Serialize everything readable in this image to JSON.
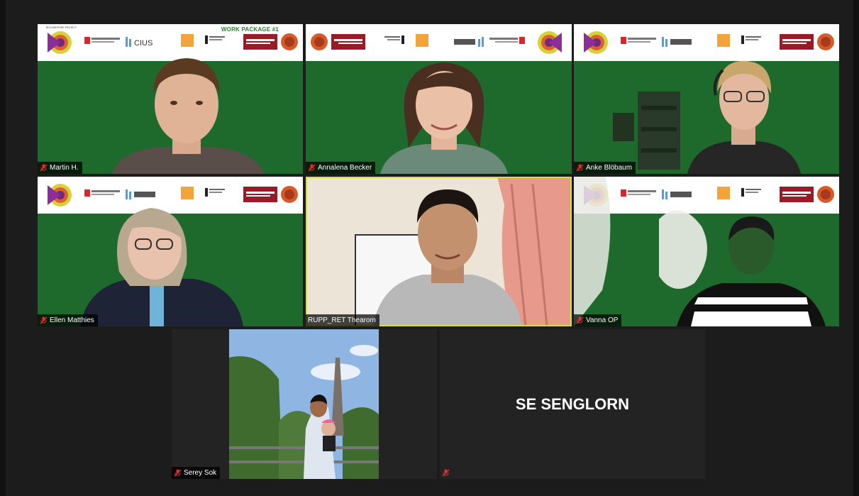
{
  "colors": {
    "background": "#1c1c1c",
    "green_screen": "#1e6a2c",
    "active_speaker": "#d8de3a",
    "work_package": "#2e7d32",
    "mic_off": "#e0302a"
  },
  "banner": {
    "project_label": "BIOCAREPORE PROJECT",
    "consortium_label": "CONSORTIUM LEADER",
    "partner_label": "PROJECT MANAGEMENT PARTNER",
    "inspired_label": "INSPIRED BY",
    "sponsored_label": "SPONSORED BY THE",
    "work_package": "WORK PACKAGE #1",
    "cius_logo": "CIUS",
    "university_logo": "UNIVERSITÄT HAMBURG"
  },
  "participants": [
    {
      "name": "Martin H.",
      "muted": true,
      "icon": "mic-off-icon"
    },
    {
      "name": "Annalena Becker",
      "muted": true,
      "icon": "mic-off-icon"
    },
    {
      "name": "Anke Blöbaum",
      "muted": true,
      "icon": "mic-off-icon"
    },
    {
      "name": "Ellen Matthies",
      "muted": true,
      "icon": "mic-off-icon"
    },
    {
      "name": "RUPP_RET Thearom",
      "muted": false,
      "active_speaker": true
    },
    {
      "name": "Vanna OP",
      "muted": true,
      "icon": "mic-off-icon"
    },
    {
      "name": "Serey Sok",
      "muted": true,
      "icon": "mic-off-icon"
    },
    {
      "name": "",
      "display_name": "SE SENGLORN",
      "muted": true,
      "icon": "mic-off-icon",
      "video_off": true
    }
  ]
}
